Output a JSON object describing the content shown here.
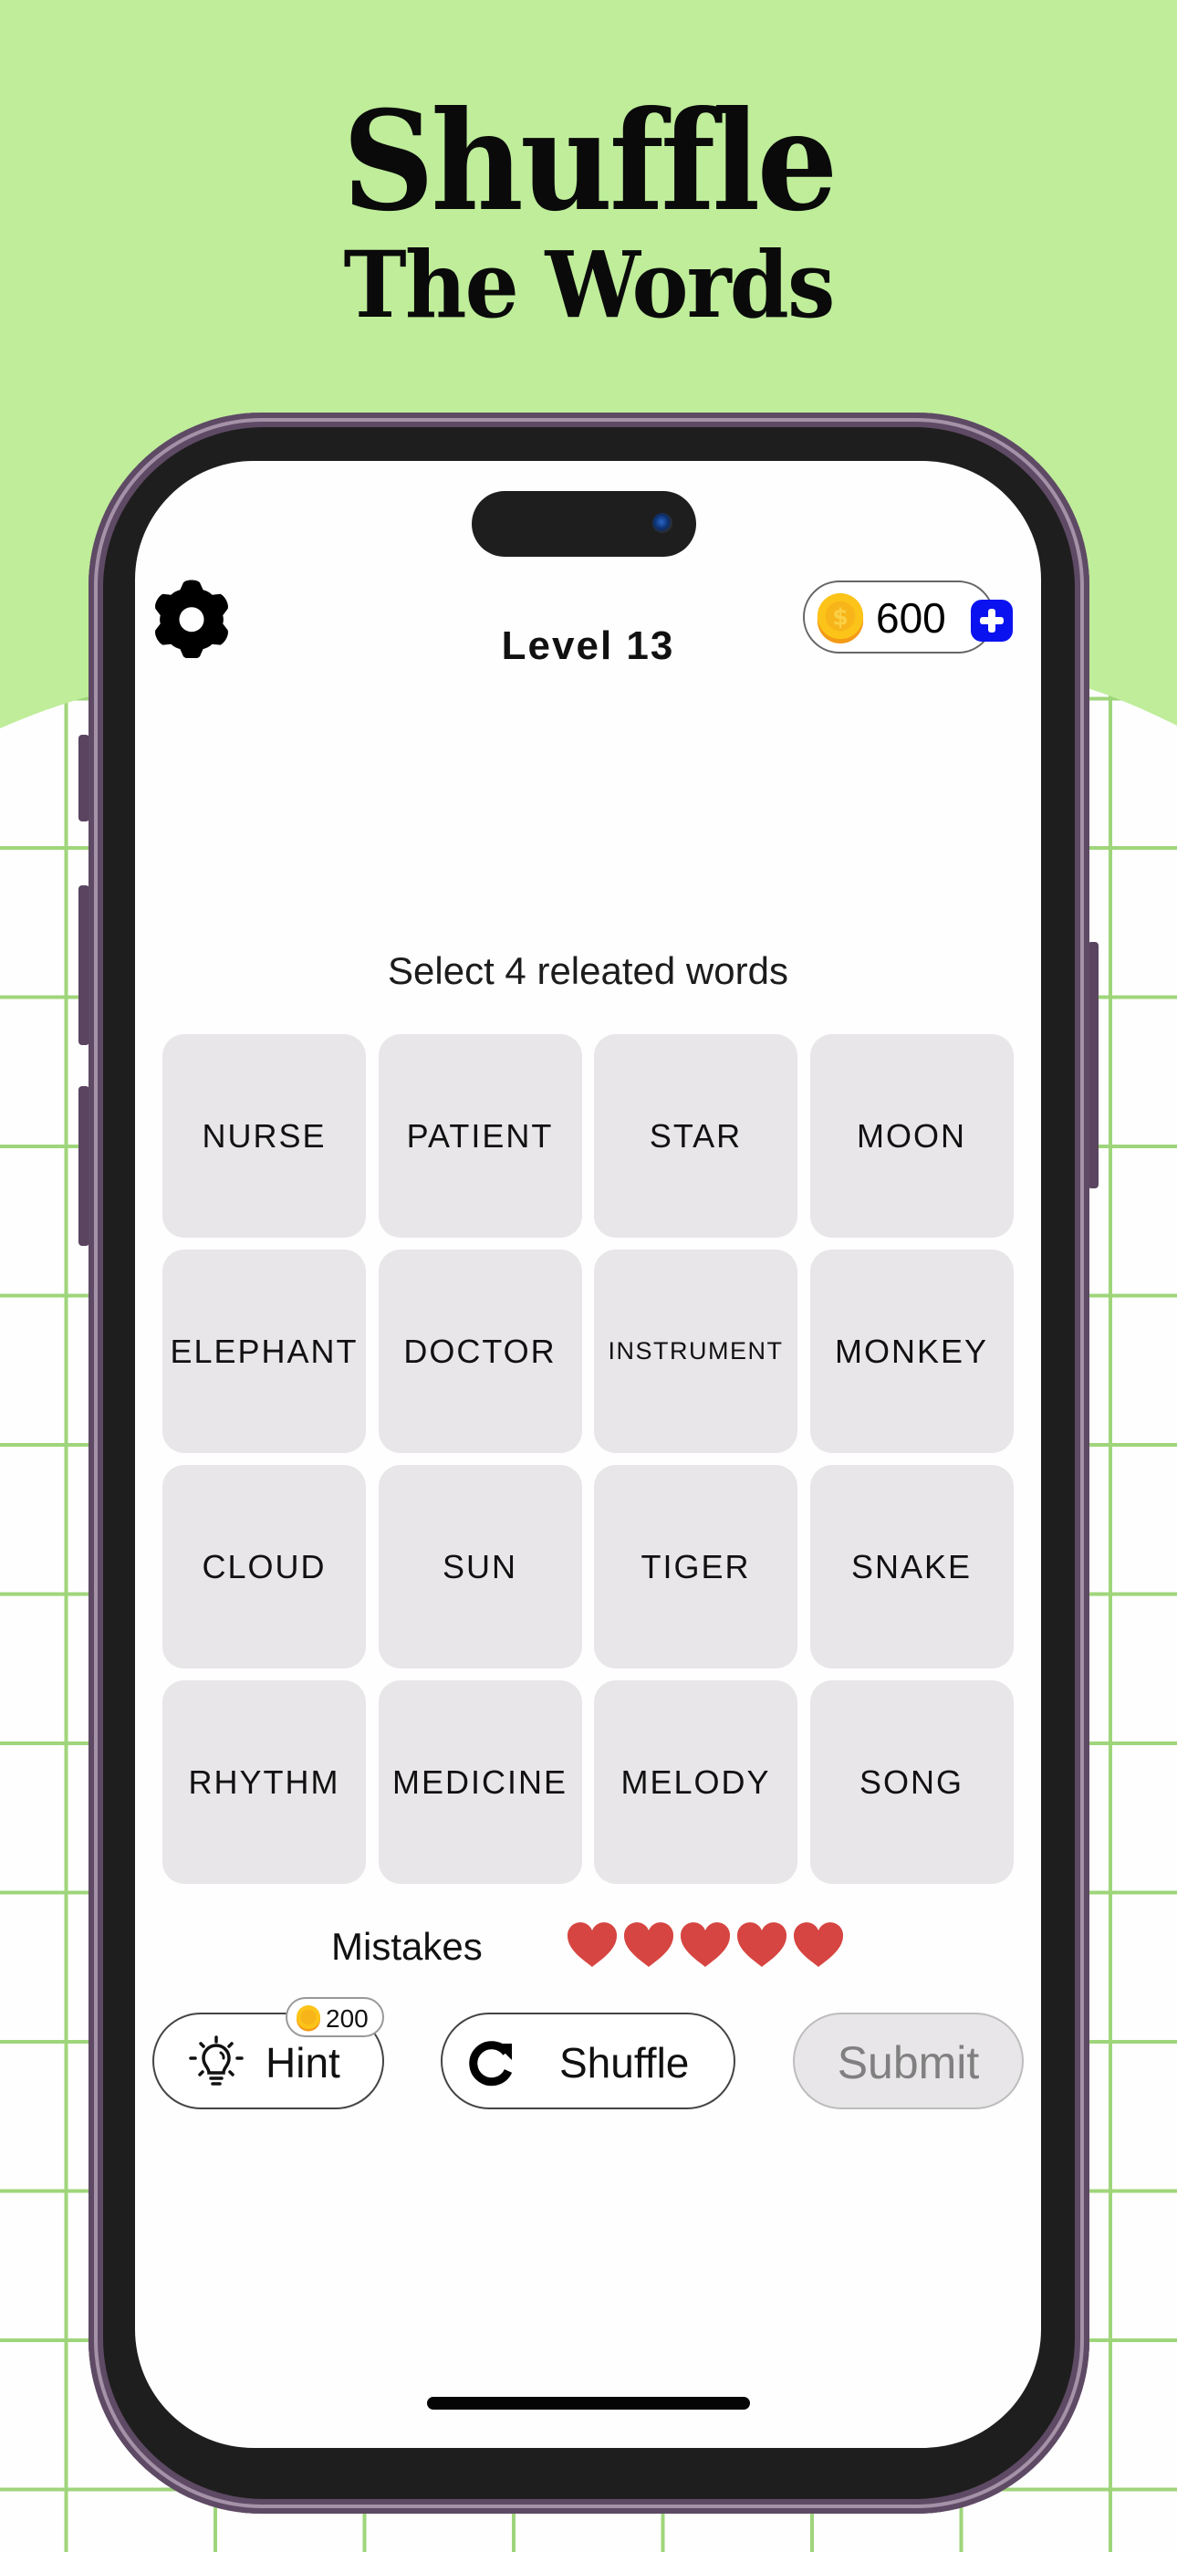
{
  "promo": {
    "headline_line1": "Shuffle",
    "headline_line2": "The Words",
    "colors": {
      "background_green": "#bfed9a",
      "grid_line": "#9fd57a",
      "phone_frame": "#5e4a64"
    }
  },
  "header": {
    "settings_icon": "gear-icon",
    "level_label": "Level 13",
    "coins": {
      "icon": "gold-coin-icon",
      "value": "600",
      "add_icon": "plus-icon",
      "add_color": "#0a12f0"
    }
  },
  "game": {
    "instruction": "Select 4 releated words",
    "words": [
      "NURSE",
      "PATIENT",
      "STAR",
      "MOON",
      "ELEPHANT",
      "DOCTOR",
      "INSTRUMENT",
      "MONKEY",
      "CLOUD",
      "SUN",
      "TIGER",
      "SNAKE",
      "RHYTHM",
      "MEDICINE",
      "MELODY",
      "SONG"
    ],
    "card_color": "#e8e6e8",
    "mistakes": {
      "label": "Mistakes",
      "hearts_remaining": 5,
      "hearts_total": 5,
      "heart_color": "#d64541"
    }
  },
  "actions": {
    "hint": {
      "label": "Hint",
      "icon": "lightbulb-icon",
      "cost": "200",
      "cost_icon": "gold-coin-icon"
    },
    "shuffle": {
      "label": "Shuffle",
      "icon": "refresh-icon"
    },
    "submit": {
      "label": "Submit",
      "disabled": true
    }
  }
}
